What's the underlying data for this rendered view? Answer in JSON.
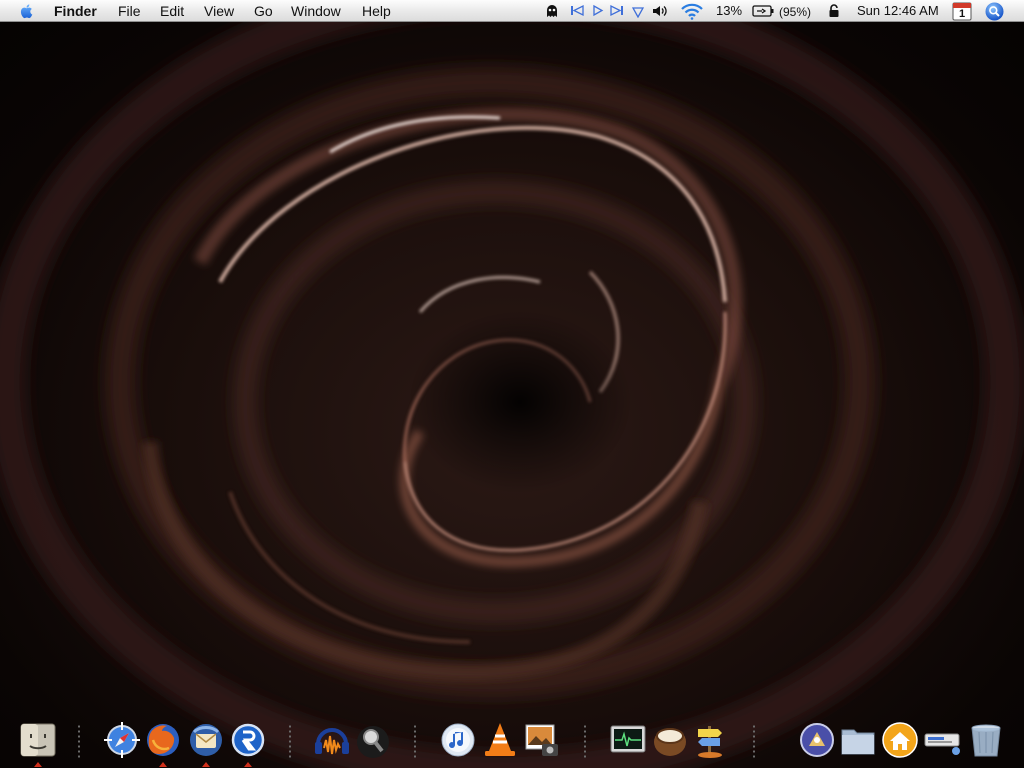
{
  "menubar": {
    "apple_icon": "apple-logo-icon",
    "app_name": "Finder",
    "menus": [
      "File",
      "Edit",
      "View",
      "Go",
      "Window",
      "Help"
    ],
    "status": {
      "cpu_percent": "13%",
      "battery_percent": "(95%)",
      "clock": "Sun 12:46 AM",
      "calendar_day": "1"
    },
    "status_icons": [
      "ghost-icon",
      "previous-track-icon",
      "play-icon",
      "next-track-icon",
      "dropdown-icon",
      "volume-icon",
      "wifi-icon",
      "battery-icon",
      "lock-icon",
      "calendar-icon",
      "spotlight-search-icon"
    ]
  },
  "dock": {
    "items": [
      {
        "name": "finder",
        "running": true
      },
      {
        "name": "safari",
        "running": false
      },
      {
        "name": "firefox",
        "running": true
      },
      {
        "name": "thunderbird",
        "running": true
      },
      {
        "name": "realplayer",
        "running": true
      },
      {
        "name": "audacity",
        "running": false
      },
      {
        "name": "spotlight-app",
        "running": false
      },
      {
        "name": "itunes",
        "running": false
      },
      {
        "name": "vlc",
        "running": false
      },
      {
        "name": "iphoto",
        "running": false
      },
      {
        "name": "activity-monitor",
        "running": false
      },
      {
        "name": "coconut-battery",
        "running": false
      },
      {
        "name": "directory-utility",
        "running": false
      },
      {
        "name": "macmini-app",
        "running": false
      },
      {
        "name": "applications-folder",
        "running": false
      },
      {
        "name": "home-folder",
        "running": false
      },
      {
        "name": "network-preferences",
        "running": false
      },
      {
        "name": "trash",
        "running": false
      }
    ]
  },
  "colors": {
    "menubar_bg": "#ececec",
    "wallpaper_dark": "#0b0605",
    "swirl_highlight": "#f2d2c4",
    "running_indicator": "#d0301c"
  }
}
